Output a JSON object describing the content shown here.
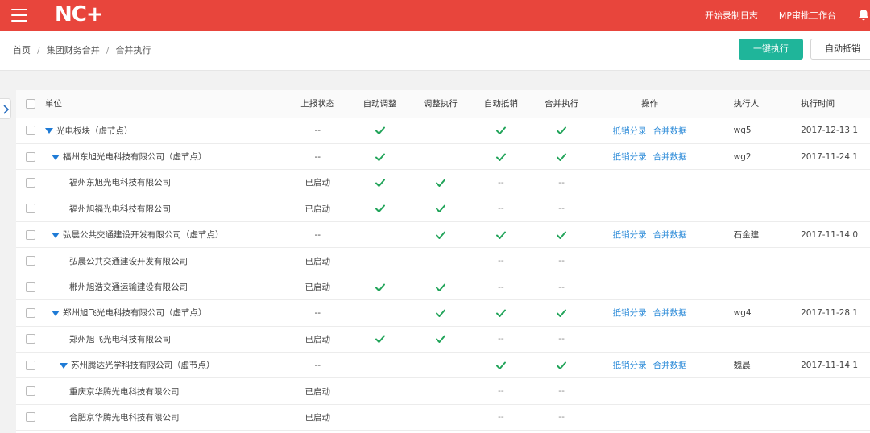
{
  "header": {
    "logo": "NC+",
    "links": [
      "开始录制日志",
      "MP审批工作台"
    ]
  },
  "breadcrumb": [
    "首页",
    "集团财务合并",
    "合并执行"
  ],
  "buttons": {
    "primary": "一键执行",
    "secondary": "自动抵销"
  },
  "table": {
    "columns": [
      "单位",
      "上报状态",
      "自动调整",
      "调整执行",
      "自动抵销",
      "合并执行",
      "操作",
      "执行人",
      "执行时间"
    ],
    "rows": [
      {
        "name": "光电板块（虚节点）",
        "level": 0,
        "expand": true,
        "status": "--",
        "auto": "check",
        "adj": "",
        "off": "check",
        "merge": "check",
        "ops": [
          "抵销分录",
          "合并数据"
        ],
        "exec": "wg5",
        "time": "2017-12-13 1"
      },
      {
        "name": "福州东旭光电科技有限公司（虚节点）",
        "level": 1,
        "expand": true,
        "status": "--",
        "auto": "check",
        "adj": "",
        "off": "check",
        "merge": "check",
        "ops": [
          "抵销分录",
          "合并数据"
        ],
        "exec": "wg2",
        "time": "2017-11-24 1"
      },
      {
        "name": "福州东旭光电科技有限公司",
        "level": 2,
        "expand": false,
        "status": "已启动",
        "auto": "check",
        "adj": "check",
        "off": "--",
        "merge": "--",
        "ops": [],
        "exec": "",
        "time": ""
      },
      {
        "name": "福州旭福光电科技有限公司",
        "level": 2,
        "expand": false,
        "status": "已启动",
        "auto": "check",
        "adj": "check",
        "off": "--",
        "merge": "--",
        "ops": [],
        "exec": "",
        "time": ""
      },
      {
        "name": "弘晨公共交通建设开发有限公司（虚节点）",
        "level": 1,
        "expand": true,
        "status": "--",
        "auto": "",
        "adj": "check",
        "off": "check",
        "merge": "check",
        "ops": [
          "抵销分录",
          "合并数据"
        ],
        "exec": "石金建",
        "time": "2017-11-14 0"
      },
      {
        "name": "弘晨公共交通建设开发有限公司",
        "level": 2,
        "expand": false,
        "status": "已启动",
        "auto": "",
        "adj": "",
        "off": "--",
        "merge": "--",
        "ops": [],
        "exec": "",
        "time": ""
      },
      {
        "name": "郴州旭浩交通运输建设有限公司",
        "level": 2,
        "expand": false,
        "status": "已启动",
        "auto": "check",
        "adj": "check",
        "off": "--",
        "merge": "--",
        "ops": [],
        "exec": "",
        "time": ""
      },
      {
        "name": "郑州旭飞光电科技有限公司（虚节点）",
        "level": 1,
        "expand": true,
        "status": "--",
        "auto": "",
        "adj": "check",
        "off": "check",
        "merge": "check",
        "ops": [
          "抵销分录",
          "合并数据"
        ],
        "exec": "wg4",
        "time": "2017-11-28 1"
      },
      {
        "name": "郑州旭飞光电科技有限公司",
        "level": 2,
        "expand": false,
        "status": "已启动",
        "auto": "check",
        "adj": "check",
        "off": "--",
        "merge": "--",
        "ops": [],
        "exec": "",
        "time": ""
      },
      {
        "name": "苏州腾达光学科技有限公司（虚节点）",
        "level": 1.5,
        "expand": true,
        "status": "--",
        "auto": "",
        "adj": "",
        "off": "check",
        "merge": "check",
        "ops": [
          "抵销分录",
          "合并数据"
        ],
        "exec": "魏晨",
        "time": "2017-11-14 1"
      },
      {
        "name": "重庆京华腾光电科技有限公司",
        "level": 2,
        "expand": false,
        "status": "已启动",
        "auto": "",
        "adj": "",
        "off": "--",
        "merge": "--",
        "ops": [],
        "exec": "",
        "time": ""
      },
      {
        "name": "合肥京华腾光电科技有限公司",
        "level": 2,
        "expand": false,
        "status": "已启动",
        "auto": "",
        "adj": "",
        "off": "--",
        "merge": "--",
        "ops": [],
        "exec": "",
        "time": ""
      }
    ]
  },
  "colors": {
    "brand": "#e8453c",
    "primary_button": "#1fb59a",
    "check": "#22a45a",
    "link": "#2a8ad8",
    "tree_arrow": "#1f7bd6"
  }
}
